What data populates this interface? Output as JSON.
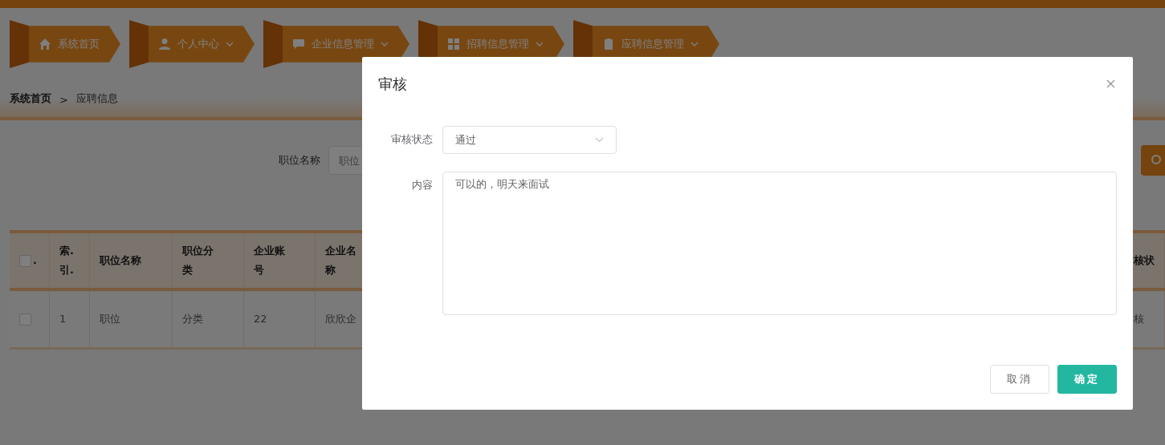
{
  "nav": [
    {
      "label": "系统首页",
      "dropdown": false
    },
    {
      "label": "个人中心",
      "dropdown": true
    },
    {
      "label": "企业信息管理",
      "dropdown": true
    },
    {
      "label": "招聘信息管理",
      "dropdown": true
    },
    {
      "label": "应聘信息管理",
      "dropdown": true
    }
  ],
  "breadcrumb": {
    "items": [
      "系统首页",
      "应聘信息"
    ],
    "separator": ">"
  },
  "search": {
    "label": "职位名称",
    "placeholder": "职位"
  },
  "table": {
    "header_checkbox": {
      "checked": false,
      "label": "."
    },
    "columns": [
      "索.引.",
      "职位名称",
      "职位分类",
      "企业账号",
      "企业名称",
      "核状"
    ],
    "rows": [
      {
        "checked": false,
        "cells": [
          "1",
          "职位",
          "分类",
          "22",
          "欣欣企",
          "核"
        ]
      }
    ]
  },
  "dialog": {
    "title": "审核",
    "fields": [
      {
        "kind": "select",
        "label": "审核状态",
        "value": "通过"
      },
      {
        "kind": "textarea",
        "label": "内容",
        "value": "可以的，明天来面试"
      }
    ],
    "buttons": [
      {
        "label": "取消",
        "primary": false
      },
      {
        "label": "确定",
        "primary": true
      }
    ]
  }
}
